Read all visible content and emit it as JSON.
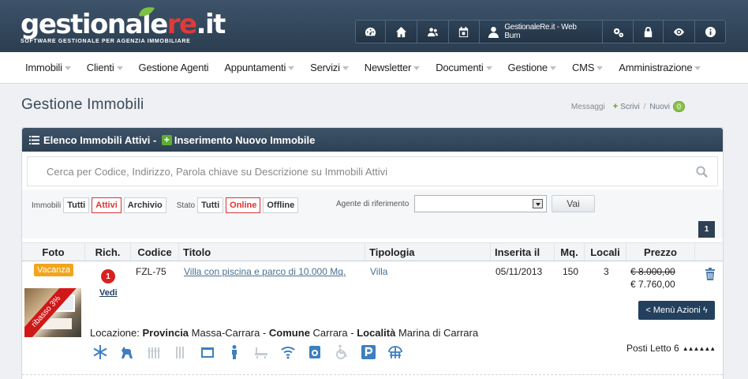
{
  "logo": {
    "part1": "gestionale",
    "part2": "re",
    "part3": ".it",
    "tagline": "SOFTWARE GESTIONALE PER AGENZIA IMMOBILIARE"
  },
  "topbar": {
    "user_label": "GestionaleRe.it - Web Burn"
  },
  "nav": [
    "Immobili",
    "Clienti",
    "Gestione Agenti",
    "Appuntamenti",
    "Servizi",
    "Newsletter",
    "Documenti",
    "Gestione",
    "CMS",
    "Amministrazione"
  ],
  "page": {
    "title": "Gestione Immobili"
  },
  "messages": {
    "label": "Messaggi",
    "write": "Scrivi",
    "new_label": "Nuovi",
    "new_count": "0"
  },
  "panel": {
    "list_label": "Elenco Immobili Attivi",
    "sep": " - ",
    "insert_label": "Inserimento Nuovo Immobile"
  },
  "search": {
    "placeholder": "Cerca per Codice, Indirizzo, Parola chiave su Descrizione su Immobili Attivi"
  },
  "filters": {
    "immobili_label": "Immobili",
    "immobili": [
      "Tutti",
      "Attivi",
      "Archivio"
    ],
    "stato_label": "Stato",
    "stato": [
      "Tutti",
      "Online",
      "Offline"
    ],
    "agent_label": "Agente di riferimento",
    "go_label": "Vai"
  },
  "pagination": {
    "current": "1"
  },
  "table": {
    "headers": [
      "Foto",
      "Rich.",
      "Codice",
      "Titolo",
      "Tipologia",
      "Inserita il",
      "Mq.",
      "Locali",
      "Prezzo"
    ],
    "row": {
      "badge": "Vacanza",
      "ribbon": "ribasso 3%",
      "richieste": "1",
      "vedi": "Vedi",
      "codice": "FZL-75",
      "titolo": "Villa con piscina e parco di 10.000 Mq.",
      "tipologia": "Villa",
      "inserita": "05/11/2013",
      "mq": "150",
      "locali": "3",
      "prezzo_old": "€ 8.000,00",
      "prezzo_new": "€ 7.760,00",
      "azioni": "< Menù Azioni",
      "loc_prov_label": "Provincia",
      "loc_prov": "Massa-Carrara",
      "loc_com_label": "Comune",
      "loc_com": "Carrara",
      "loc_loc_label": "Località",
      "loc_loc": "Marina di Carrara",
      "loc_prefix": "Locazione:",
      "posti_letto": "Posti Letto 6"
    }
  },
  "colors": {
    "header": "#2e4154",
    "accent_red": "#d33333",
    "green": "#5cae34",
    "badge_orange": "#f2a51b"
  }
}
